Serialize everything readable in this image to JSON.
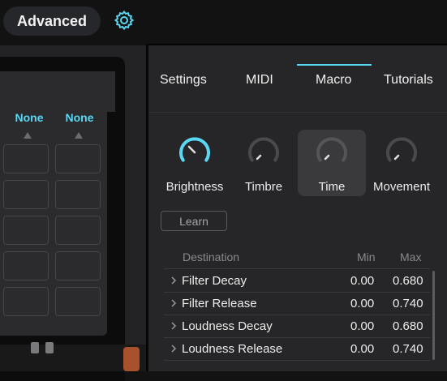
{
  "header": {
    "advanced_label": "Advanced",
    "settings_icon": "gear-icon",
    "accent": "#5ad7f2"
  },
  "left_panel": {
    "columns": [
      "None",
      "None"
    ]
  },
  "tabs": [
    "Settings",
    "MIDI",
    "Macro",
    "Tutorials"
  ],
  "active_tab": "Macro",
  "macros": [
    {
      "label": "Brightness",
      "active": true,
      "level": 0.5
    },
    {
      "label": "Timbre",
      "active": false,
      "level": 0.0
    },
    {
      "label": "Time",
      "active": false,
      "level": 0.0,
      "selected": true
    },
    {
      "label": "Movement",
      "active": false,
      "level": 0.0
    }
  ],
  "learn_label": "Learn",
  "table": {
    "headers": {
      "destination": "Destination",
      "min": "Min",
      "max": "Max"
    },
    "rows": [
      {
        "destination": "Filter Decay",
        "min": "0.00",
        "max": "0.680"
      },
      {
        "destination": "Filter Release",
        "min": "0.00",
        "max": "0.740"
      },
      {
        "destination": "Loudness Decay",
        "min": "0.00",
        "max": "0.680"
      },
      {
        "destination": "Loudness Release",
        "min": "0.00",
        "max": "0.740"
      }
    ]
  }
}
